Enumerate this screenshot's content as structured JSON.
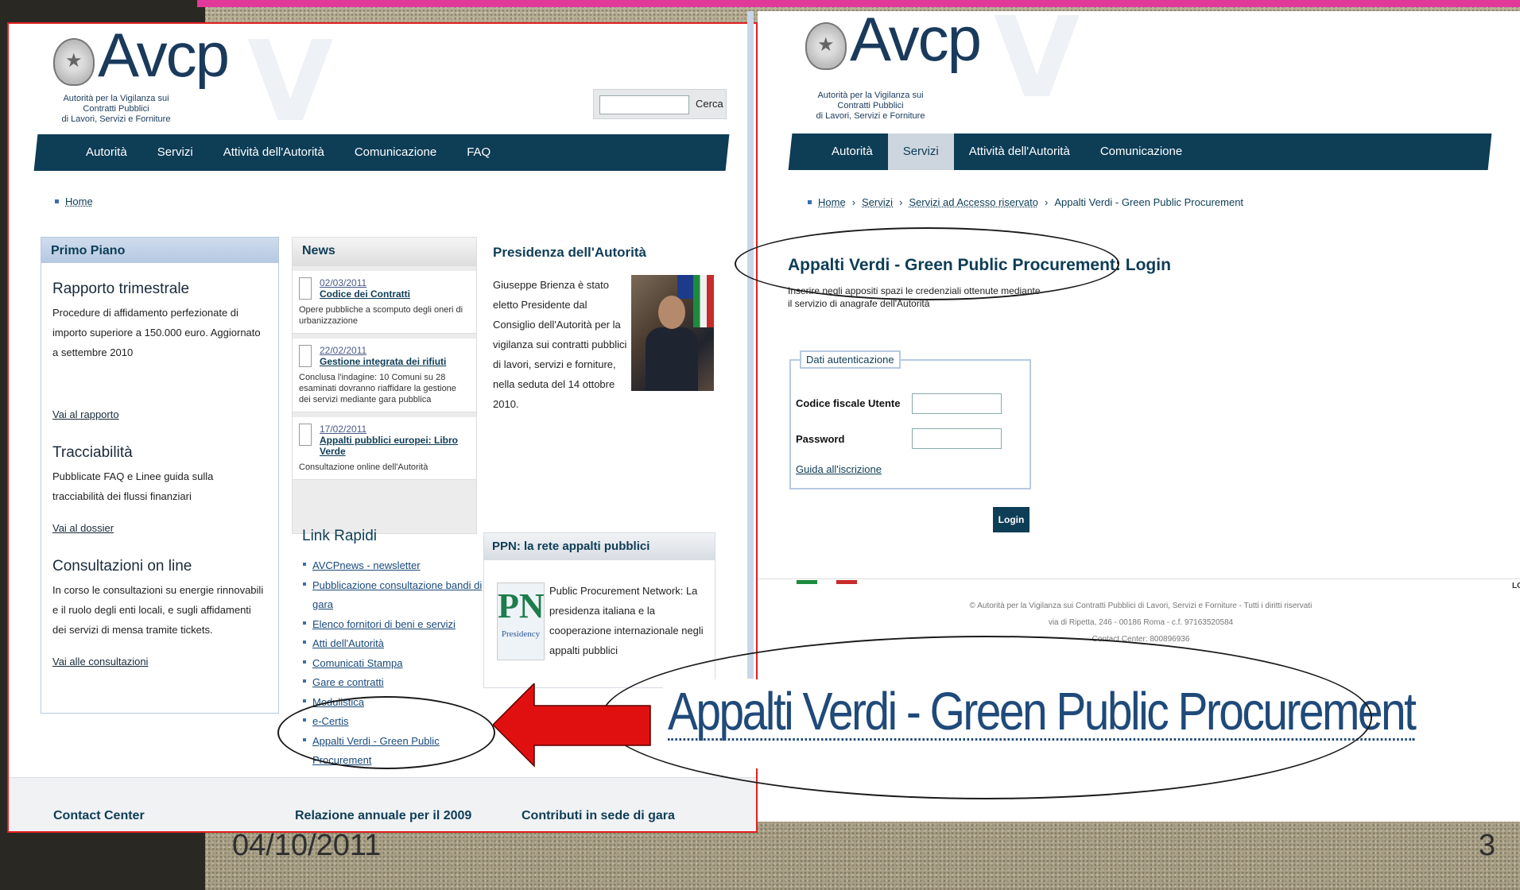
{
  "slide": {
    "date": "04/10/2011",
    "page_number": "3",
    "accent_color": "#e0399a"
  },
  "left": {
    "logo_word": "Avcp",
    "logo_sub_1": "Autorità per la Vigilanza sui Contratti Pubblici",
    "logo_sub_2": "di Lavori, Servizi e Forniture",
    "search_button": "Cerca",
    "nav": [
      "Autorità",
      "Servizi",
      "Attività dell'Autorità",
      "Comunicazione",
      "FAQ"
    ],
    "breadcrumb_home": "Home",
    "primo_piano": {
      "title": "Primo Piano",
      "items": [
        {
          "heading": "Rapporto trimestrale",
          "text": "Procedure di affidamento perfezionate di importo superiore a 150.000 euro. Aggiornato a settembre 2010",
          "link": "Vai al rapporto"
        },
        {
          "heading": "Tracciabilità",
          "text": "Pubblicate FAQ e Linee guida sulla tracciabilità dei flussi finanziari",
          "link": "Vai al dossier"
        },
        {
          "heading": "Consultazioni on line",
          "text": "In corso le consultazioni su energie rinnovabili e il ruolo degli enti locali, e sugli affidamenti dei servizi di mensa tramite tickets.",
          "link": "Vai alle consultazioni"
        }
      ]
    },
    "news": {
      "title": "News",
      "items": [
        {
          "date": "02/03/2011",
          "title": "Codice dei Contratti",
          "desc": "Opere pubbliche a scomputo degli oneri di urbanizzazione"
        },
        {
          "date": "22/02/2011",
          "title": "Gestione integrata dei rifiuti",
          "desc": "Conclusa l'indagine: 10 Comuni su 28 esaminati dovranno riaffidare la gestione dei servizi mediante gara pubblica"
        },
        {
          "date": "17/02/2011",
          "title": "Appalti pubblici europei: Libro Verde",
          "desc": "Consultazione online dell'Autorità"
        }
      ]
    },
    "presidenza": {
      "title": "Presidenza dell'Autorità",
      "text": "Giuseppe Brienza è stato eletto Presidente dal Consiglio dell'Autorità per la vigilanza sui contratti pubblici di lavori, servizi e forniture, nella seduta del 14 ottobre 2010."
    },
    "link_rapidi": {
      "title": "Link Rapidi",
      "items": [
        "AVCPnews - newsletter",
        "Pubblicazione consultazione bandi di gara",
        "Elenco fornitori di beni e servizi",
        "Atti dell'Autorità",
        "Comunicati Stampa",
        "Gare e contratti",
        "Modulistica",
        "e-Certis",
        "Appalti Verdi - Green Public Procurement"
      ]
    },
    "ppn": {
      "title": "PPN: la rete appalti pubblici",
      "logo_letters": "PN",
      "logo_sub": "Presidency",
      "text": "Public Procurement Network: La presidenza italiana e la cooperazione internazionale negli appalti pubblici"
    },
    "bottom": [
      "Contact Center",
      "Relazione annuale per il 2009",
      "Contributi in sede di gara"
    ]
  },
  "right": {
    "logo_word": "Avcp",
    "logo_sub_1": "Autorità per la Vigilanza sui Contratti Pubblici",
    "logo_sub_2": "di Lavori, Servizi e Forniture",
    "nav": [
      "Autorità",
      "Servizi",
      "Attività dell'Autorità",
      "Comunicazione"
    ],
    "breadcrumb": [
      "Home",
      "Servizi",
      "Servizi ad Accesso riservato",
      "Appalti Verdi - Green Public Procurement"
    ],
    "login_title": "Appalti Verdi - Green Public Procurement: Login",
    "login_desc_1": "Inserire negli appositi spazi le credenziali ottenute mediante",
    "login_desc_2": "il servizio di anagrafe dell'Autorità",
    "legend": "Dati autenticazione",
    "field_user": "Codice fiscale Utente",
    "field_password": "Password",
    "guide_link": "Guida all'iscrizione",
    "login_button": "Login",
    "footer_1": "© Autorità per la Vigilanza sui Contratti Pubblici di Lavori, Servizi e Forniture - Tutti i diritti riservati",
    "footer_2": "via di Ripetta, 246 - 00186 Roma - c.f. 97163520584",
    "footer_3": "Contact Center: 800896936",
    "corner_text": "LO"
  },
  "annotation": {
    "big_label": "Appalti Verdi - Green Public Procurement",
    "arrow_color": "#e01010"
  }
}
